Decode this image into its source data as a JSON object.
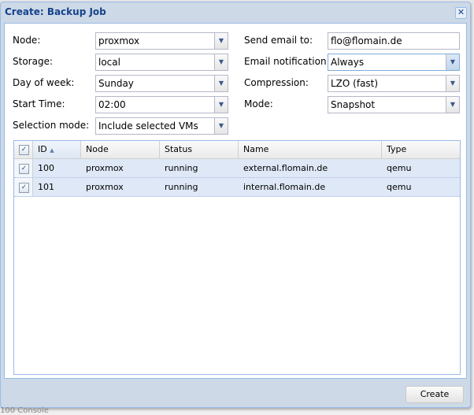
{
  "dialog": {
    "title": "Create: Backup Job",
    "close_icon": "close-icon"
  },
  "form": {
    "left": [
      {
        "label": "Node:",
        "value": "proxmox"
      },
      {
        "label": "Storage:",
        "value": "local"
      },
      {
        "label": "Day of week:",
        "value": "Sunday"
      },
      {
        "label": "Start Time:",
        "value": "02:00"
      },
      {
        "label": "Selection mode:",
        "value": "Include selected VMs"
      }
    ],
    "right": [
      {
        "label": "Send email to:",
        "value": "flo@flomain.de"
      },
      {
        "label": "Email notification:",
        "value": "Always"
      },
      {
        "label": "Compression:",
        "value": "LZO (fast)"
      },
      {
        "label": "Mode:",
        "value": "Snapshot"
      }
    ]
  },
  "grid": {
    "columns": [
      "ID",
      "Node",
      "Status",
      "Name",
      "Type"
    ],
    "sort_icon": "sort-ascending-icon",
    "rows": [
      {
        "id": "100",
        "node": "proxmox",
        "status": "running",
        "name": "external.flomain.de",
        "type": "qemu",
        "checked": true
      },
      {
        "id": "101",
        "node": "proxmox",
        "status": "running",
        "name": "internal.flomain.de",
        "type": "qemu",
        "checked": true
      }
    ]
  },
  "footer": {
    "create_label": "Create"
  },
  "background": {
    "bottom_text": "100   Console"
  }
}
